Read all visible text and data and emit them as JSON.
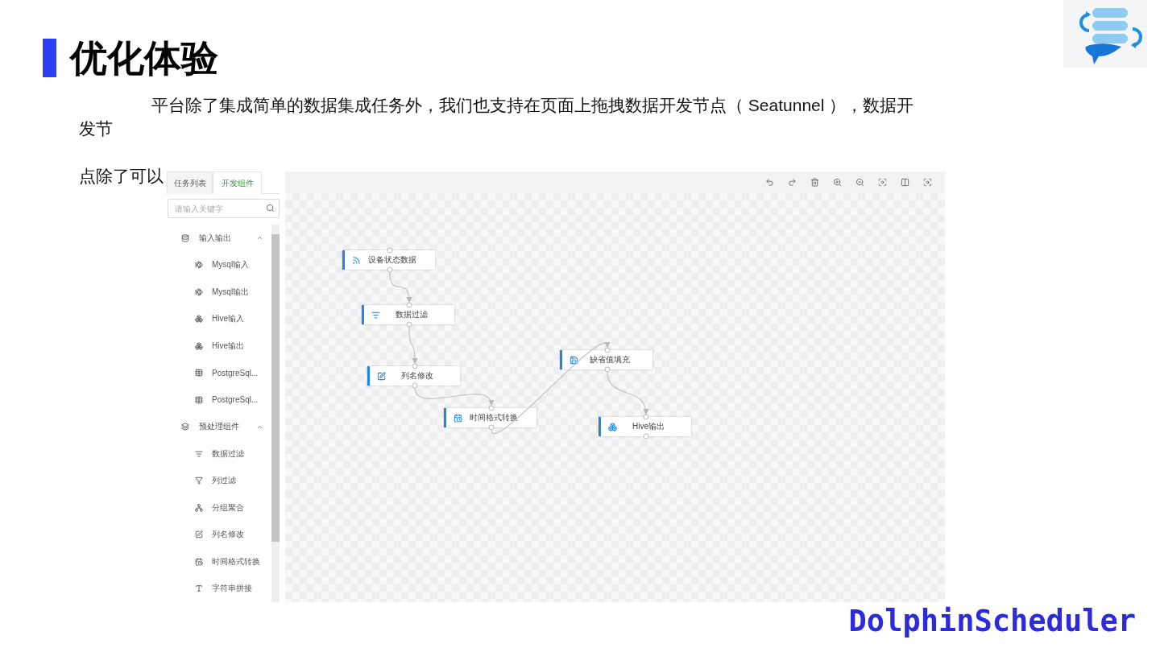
{
  "slide": {
    "title": "优化体验",
    "paragraph_lines": [
      "平台除了集成简单的数据集成任务外，我们也支持在页面上拖拽数据开发节点（ Seatunnel ），数据开",
      "发节",
      "点除了可以"
    ],
    "brand": "DolphinScheduler"
  },
  "screenshot": {
    "tabs": [
      {
        "label": "任务列表",
        "selected": false
      },
      {
        "label": "开发组件",
        "selected": true
      }
    ],
    "search": {
      "placeholder": "请输入关键字"
    },
    "tree": [
      {
        "label": "输入输出",
        "kind": "database",
        "expanded": true,
        "children": [
          {
            "label": "Mysql输入",
            "kind": "mysql"
          },
          {
            "label": "Mysql输出",
            "kind": "mysql"
          },
          {
            "label": "Hive输入",
            "kind": "hive"
          },
          {
            "label": "Hive输出",
            "kind": "hive"
          },
          {
            "label": "PostgreSql...",
            "kind": "postgres"
          },
          {
            "label": "PostgreSql...",
            "kind": "postgres"
          }
        ]
      },
      {
        "label": "预处理组件",
        "kind": "layers",
        "expanded": true,
        "children": [
          {
            "label": "数据过滤",
            "kind": "filter"
          },
          {
            "label": "列过滤",
            "kind": "column_filter"
          },
          {
            "label": "分组聚合",
            "kind": "group"
          },
          {
            "label": "列名修改",
            "kind": "rename"
          },
          {
            "label": "时间格式转换",
            "kind": "time"
          },
          {
            "label": "字符串拼接",
            "kind": "string"
          }
        ]
      }
    ],
    "nodes": [
      {
        "label": "设备状态数据",
        "kind": "source"
      },
      {
        "label": "数据过滤",
        "kind": "filter"
      },
      {
        "label": "列名修改",
        "kind": "rename"
      },
      {
        "label": "时间格式转换",
        "kind": "time"
      },
      {
        "label": "缺省值填充",
        "kind": "fill"
      },
      {
        "label": "Hive输出",
        "kind": "hive"
      }
    ]
  }
}
